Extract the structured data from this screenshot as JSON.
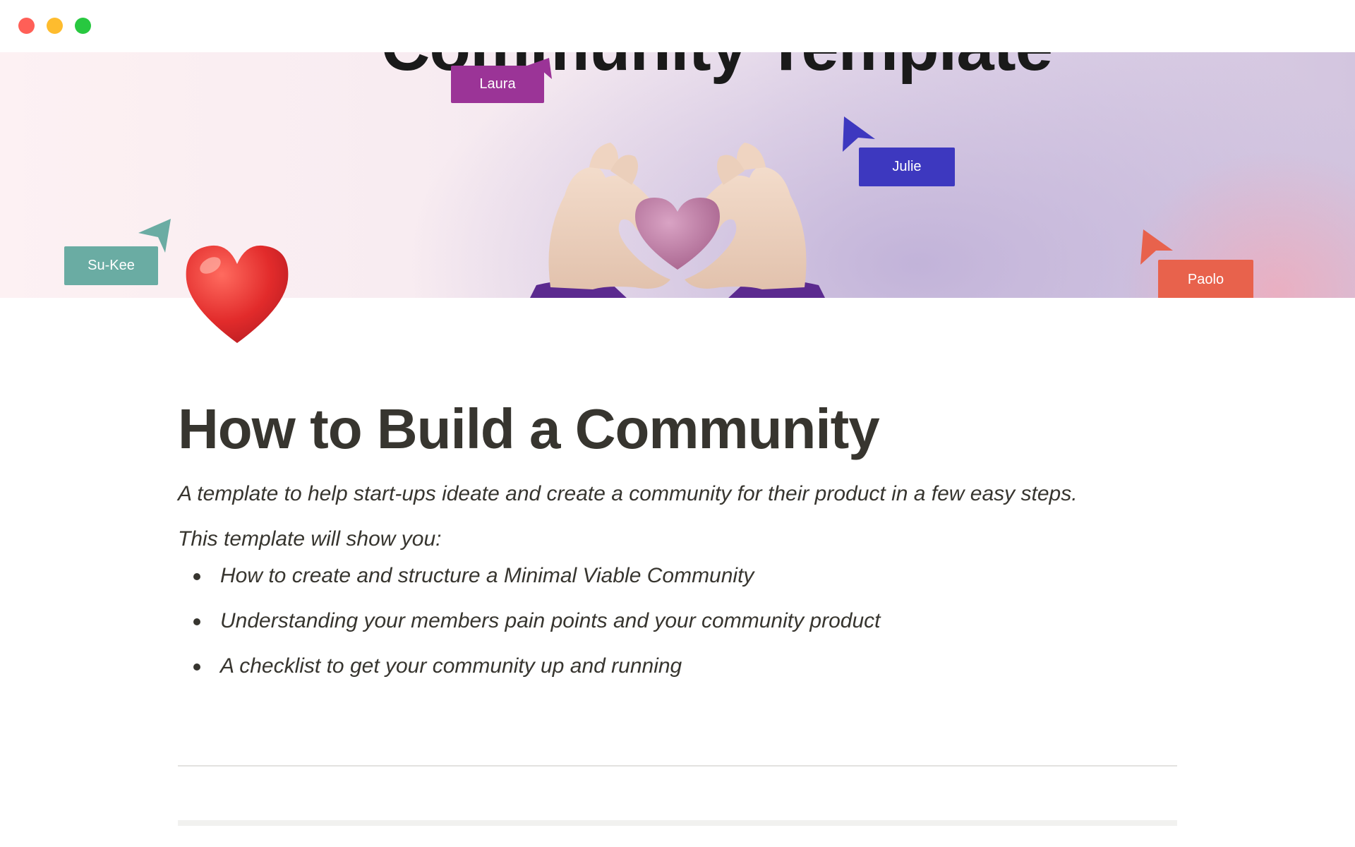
{
  "window": {
    "controls": {
      "close_color": "#ff5f57",
      "minimize_color": "#febc2e",
      "zoom_color": "#28c840"
    }
  },
  "cover": {
    "title_text": "Community Template",
    "collaborators": [
      {
        "name": "Laura",
        "color": "#9b3497"
      },
      {
        "name": "Julie",
        "color": "#3d38bf"
      },
      {
        "name": "Su-Kee",
        "color": "#6aaca3"
      },
      {
        "name": "Paolo",
        "color": "#e8624c"
      }
    ]
  },
  "page": {
    "icon": "red-heart-icon",
    "title": "How to Build a Community",
    "description": "A template to help start-ups ideate and create a community for their product in a few easy steps.",
    "intro": "This template will show you:",
    "bullets": [
      "How to create and structure a Minimal Viable Community",
      "Understanding your members pain points and your community product",
      "A checklist to get your community up and running"
    ]
  }
}
